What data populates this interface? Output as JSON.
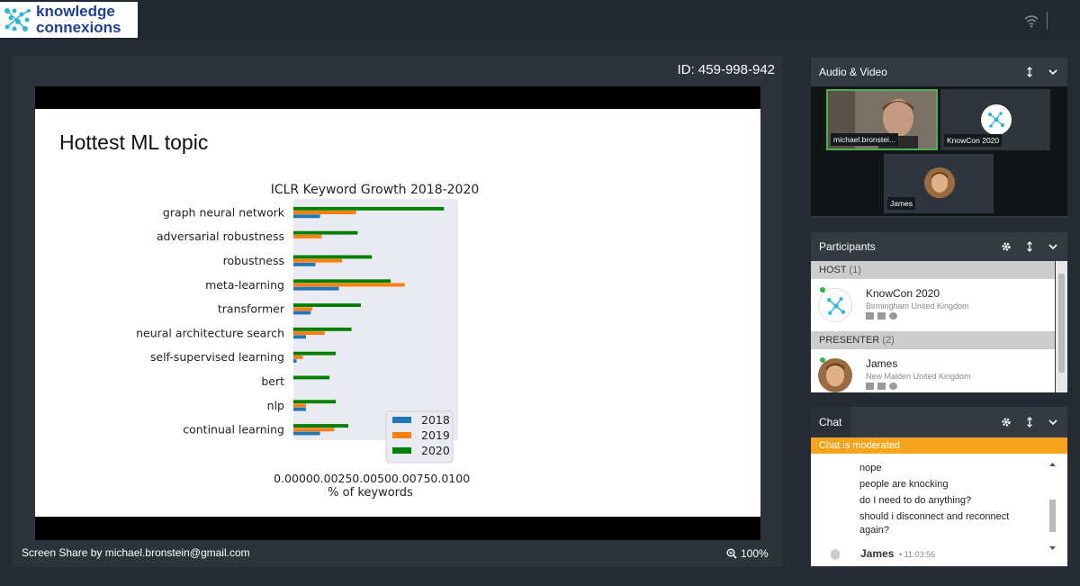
{
  "app": {
    "logo_line1": "knowledge",
    "logo_line2": "connexions"
  },
  "stage": {
    "meeting_id": "ID: 459-998-942",
    "share_label": "Screen Share by michael.bronstein@gmail.com",
    "zoom": "100%"
  },
  "slide": {
    "title": "Hottest ML topic"
  },
  "chart_data": {
    "type": "bar",
    "title": "ICLR Keyword Growth 2018-2020",
    "xlabel": "% of keywords",
    "ylabel": "",
    "orientation": "horizontal",
    "xlim": [
      0,
      0.0105
    ],
    "xticks": [
      "0.0000",
      "0.0025",
      "0.0050",
      "0.0075",
      "0.0100"
    ],
    "categories": [
      "graph neural network",
      "adversarial robustness",
      "robustness",
      "meta-learning",
      "transformer",
      "neural architecture search",
      "self-supervised learning",
      "bert",
      "nlp",
      "continual learning"
    ],
    "series": [
      {
        "name": "2018",
        "color": "#1f77b4",
        "values": [
          0.0017,
          0.0,
          0.0014,
          0.0029,
          0.0011,
          0.0008,
          0.0002,
          0.0,
          0.0008,
          0.0017
        ]
      },
      {
        "name": "2019",
        "color": "#ff7f0e",
        "values": [
          0.004,
          0.0018,
          0.0031,
          0.0071,
          0.0012,
          0.002,
          0.0006,
          0.0,
          0.0008,
          0.0026
        ]
      },
      {
        "name": "2020",
        "color": "#008000",
        "values": [
          0.0096,
          0.0041,
          0.005,
          0.0062,
          0.0043,
          0.0037,
          0.0027,
          0.0023,
          0.0027,
          0.0035
        ]
      }
    ],
    "legend_position": "lower-right",
    "grid": false,
    "background": "#eaeaf2"
  },
  "panels": {
    "audio_video": {
      "title": "Audio & Video",
      "tiles": [
        {
          "label": "michael.bronstei..."
        },
        {
          "label": "KnowCon 2020"
        },
        {
          "label": "James"
        }
      ]
    },
    "participants": {
      "title": "Participants",
      "groups": [
        {
          "name": "HOST",
          "count": "(1)",
          "members": [
            {
              "name": "KnowCon 2020",
              "location": "Birmingham United Kingdom"
            }
          ]
        },
        {
          "name": "PRESENTER",
          "count": "(2)",
          "members": [
            {
              "name": "James",
              "location": "New Malden United Kingdom"
            }
          ]
        }
      ]
    },
    "chat": {
      "title": "Chat",
      "moderated_text": "Chat is moderated",
      "messages": [
        "nope",
        "people are knocking",
        "do I need to do anything?",
        "should i disconnect and reconnect",
        "again?"
      ],
      "next_author": "James",
      "next_time": "• 11:03:56"
    }
  },
  "colors": {
    "accent_orange": "#f5a41c",
    "logo_blue": "#1e3f9a",
    "logo_cyan": "#2bb5d8"
  }
}
